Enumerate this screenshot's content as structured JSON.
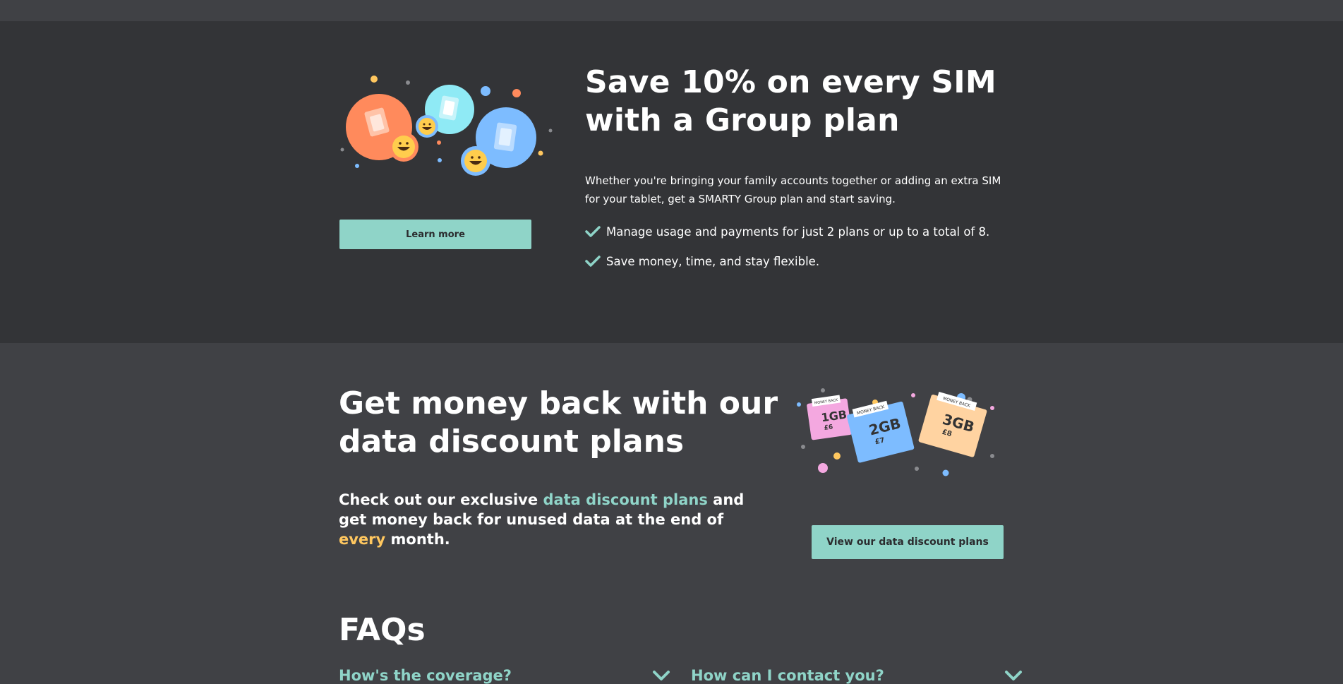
{
  "group": {
    "title_line1": "Save 10% on every SIM",
    "title_line2": "with a Group plan",
    "description": "Whether you're bringing your family accounts together or adding an extra SIM for your tablet, get a SMARTY Group plan and start saving.",
    "bullets": [
      "Manage usage and payments for just 2 plans or up to a total of 8.",
      "Save money, time, and stay flexible."
    ],
    "learn_more_label": "Learn more"
  },
  "discount": {
    "title_line1": "Get money back with our",
    "title_line2": "data discount plans",
    "body_part1": "Check out our exclusive ",
    "body_link": "data discount plans",
    "body_part2": " and get money back for unused data at the end of ",
    "body_highlight": "every",
    "body_part3": " month.",
    "view_button_label": "View our data discount plans",
    "cards": [
      {
        "tag": "MONEY BACK",
        "size": "1GB",
        "price": "£6",
        "color": "#f4a8e0"
      },
      {
        "tag": "MONEY BACK",
        "size": "2GB",
        "price": "£7",
        "color": "#7dbcff"
      },
      {
        "tag": "MONEY BACK",
        "size": "3GB",
        "price": "£8",
        "color": "#ffd3a1"
      }
    ]
  },
  "faq": {
    "title": "FAQs",
    "questions": [
      "How's the coverage?",
      "How can I contact you?"
    ]
  },
  "icons": [
    "check-icon",
    "chevron-down-icon",
    "sim-bubble-illustration",
    "data-cards-illustration"
  ],
  "colors": {
    "accent_teal": "#8fd4c8",
    "accent_yellow": "#ffc75f",
    "dark_section": "#333437",
    "light_section": "#404145"
  }
}
